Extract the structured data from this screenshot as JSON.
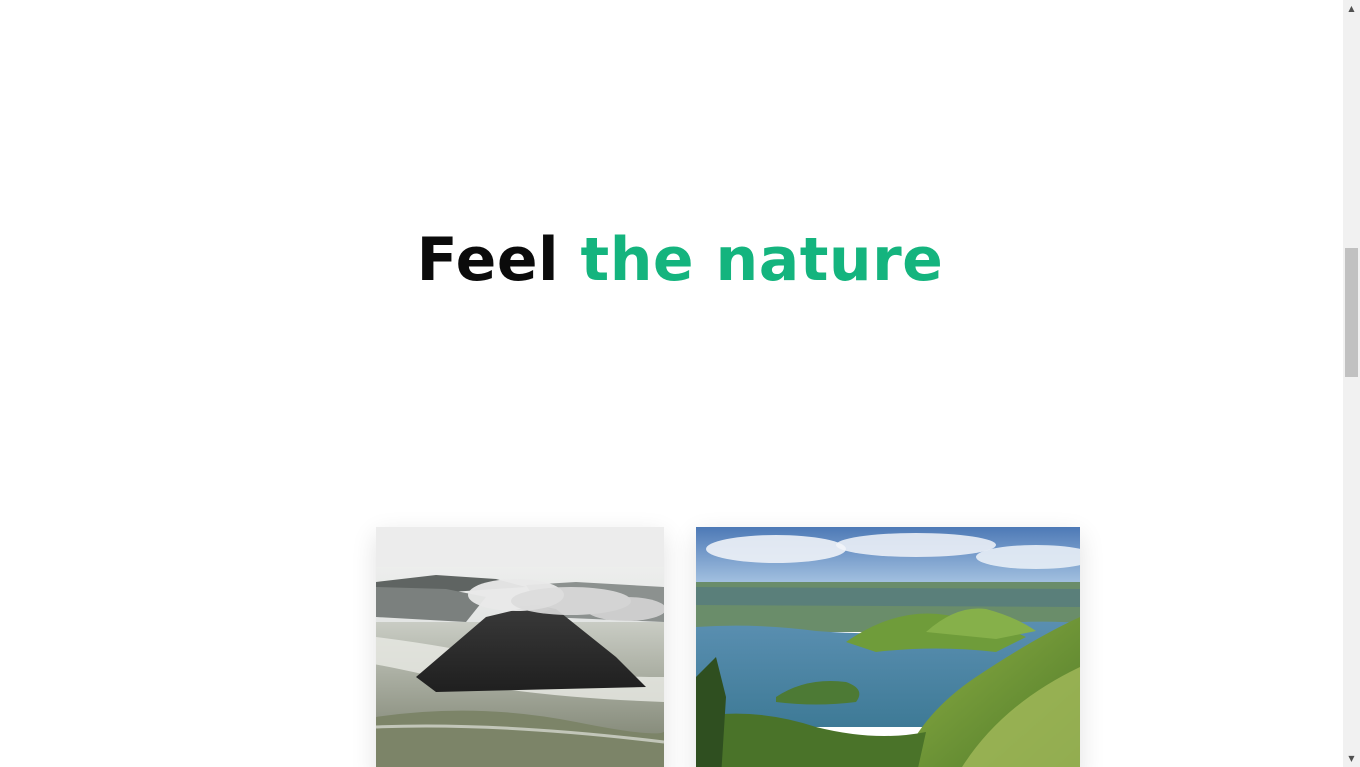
{
  "hero": {
    "title_part1": "Feel",
    "title_part2": "the nature",
    "accent_color": "#14b47e"
  },
  "cards": [
    {
      "image": "volcano-landscape",
      "caption": ""
    },
    {
      "image": "lake-valley-landscape",
      "caption": ""
    }
  ],
  "scrollbar": {
    "up_icon": "scroll-up-arrow-icon",
    "down_icon": "scroll-down-arrow-icon"
  }
}
